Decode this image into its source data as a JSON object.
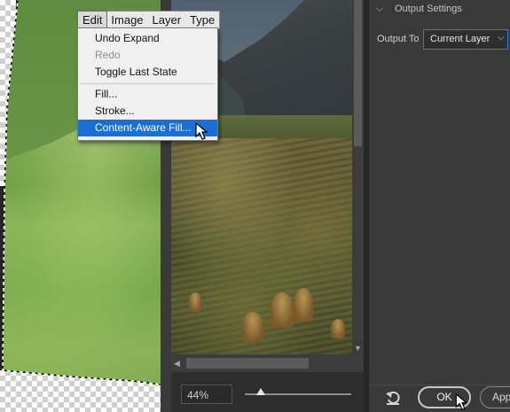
{
  "menubar": {
    "items": [
      {
        "label": "Edit",
        "active": true
      },
      {
        "label": "Image"
      },
      {
        "label": "Layer"
      },
      {
        "label": "Type"
      }
    ]
  },
  "edit_menu": {
    "items": [
      {
        "label": "Undo Expand",
        "state": "enabled"
      },
      {
        "label": "Redo",
        "state": "disabled"
      },
      {
        "label": "Toggle Last State",
        "state": "enabled"
      },
      {
        "label": "Fill...",
        "state": "enabled"
      },
      {
        "label": "Stroke...",
        "state": "enabled"
      },
      {
        "label": "Content-Aware Fill...",
        "state": "highlighted"
      }
    ]
  },
  "preview": {
    "zoom": "44%",
    "zoom_slider_level": 0.15
  },
  "output_settings": {
    "section_title": "Output Settings",
    "output_to_label": "Output To",
    "output_to_value": "Current Layer"
  },
  "actions": {
    "ok_label": "OK",
    "apply_label": "App"
  },
  "icons": {
    "section_collapse": "chevron-down-icon",
    "select_arrow": "chevron-down-icon",
    "reset": "reset-icon",
    "cursor": "arrow-cursor-icon"
  },
  "colors": {
    "menu_highlight": "#1a6fd6",
    "select_focus_border": "#2e7be0",
    "panel_bg": "#393939"
  }
}
